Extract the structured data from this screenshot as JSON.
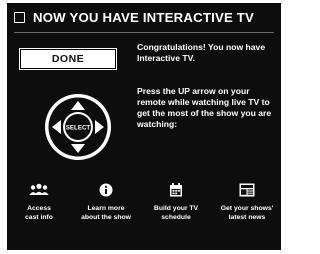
{
  "header": {
    "title": "NOW YOU HAVE INTERACTIVE TV"
  },
  "done_button": {
    "label": "DONE"
  },
  "congrats_text": "Congratulations! You now have Interactive TV.",
  "instruction_text": "Press the UP arrow on your remote while watching live TV to get the most of the show you are watching:",
  "dpad": {
    "center_label": "SELECT"
  },
  "features": [
    {
      "icon": "people-icon",
      "label_line1": "Access",
      "label_line2": "cast info"
    },
    {
      "icon": "info-icon",
      "label_line1": "Learn more",
      "label_line2": "about the show"
    },
    {
      "icon": "calendar-icon",
      "label_line1": "Build your TV",
      "label_line2": "schedule"
    },
    {
      "icon": "news-icon",
      "label_line1": "Get your shows'",
      "label_line2": "latest news"
    }
  ]
}
